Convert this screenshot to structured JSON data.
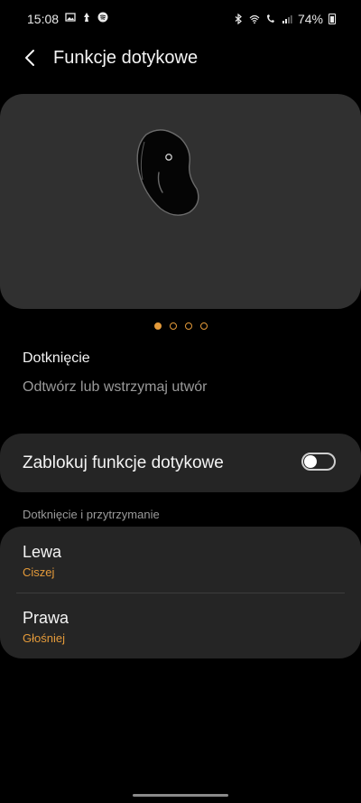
{
  "status": {
    "time": "15:08",
    "battery": "74%",
    "left_icons": [
      "image-icon",
      "notification-icon",
      "spotify-icon"
    ],
    "right_icons": [
      "bluetooth-icon",
      "wifi-icon",
      "volte-call-icon",
      "signal-icon",
      "battery-icon"
    ]
  },
  "header": {
    "title": "Funkcje dotykowe"
  },
  "carousel": {
    "pages": 4,
    "active": 0
  },
  "tap": {
    "title": "Dotknięcie",
    "action": "Odtwórz lub wstrzymaj utwór"
  },
  "lock": {
    "label": "Zablokuj funkcje dotykowe",
    "enabled": false
  },
  "hold": {
    "section_label": "Dotknięcie i przytrzymanie",
    "left": {
      "title": "Lewa",
      "value": "Ciszej"
    },
    "right": {
      "title": "Prawa",
      "value": "Głośniej"
    }
  },
  "colors": {
    "accent": "#e49a3a",
    "card": "#252525",
    "hero": "#303030",
    "background": "#000000"
  }
}
